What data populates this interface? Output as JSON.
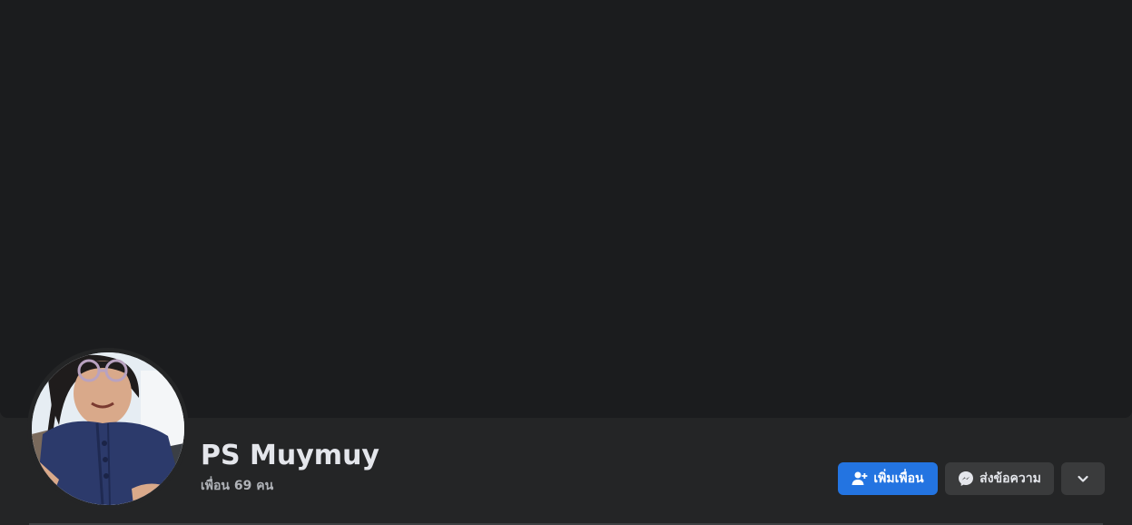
{
  "profile": {
    "name": "PS Muymuy",
    "friends_text": "เพื่อน 69 คน",
    "avatar_alt": "profile photo"
  },
  "actions": {
    "add_friend_label": "เพิ่มเพื่อน",
    "message_label": "ส่งข้อความ",
    "more_icon": "chevron-down-icon"
  },
  "icons": {
    "add_friend": "add-friend-icon",
    "messenger": "messenger-icon"
  },
  "colors": {
    "accent": "#2374e1",
    "background": "#242526",
    "cover": "#1b1c1e",
    "secondary_button": "#3a3b3c",
    "primary_text": "#e4e6eb",
    "secondary_text": "#b0b3b8"
  }
}
